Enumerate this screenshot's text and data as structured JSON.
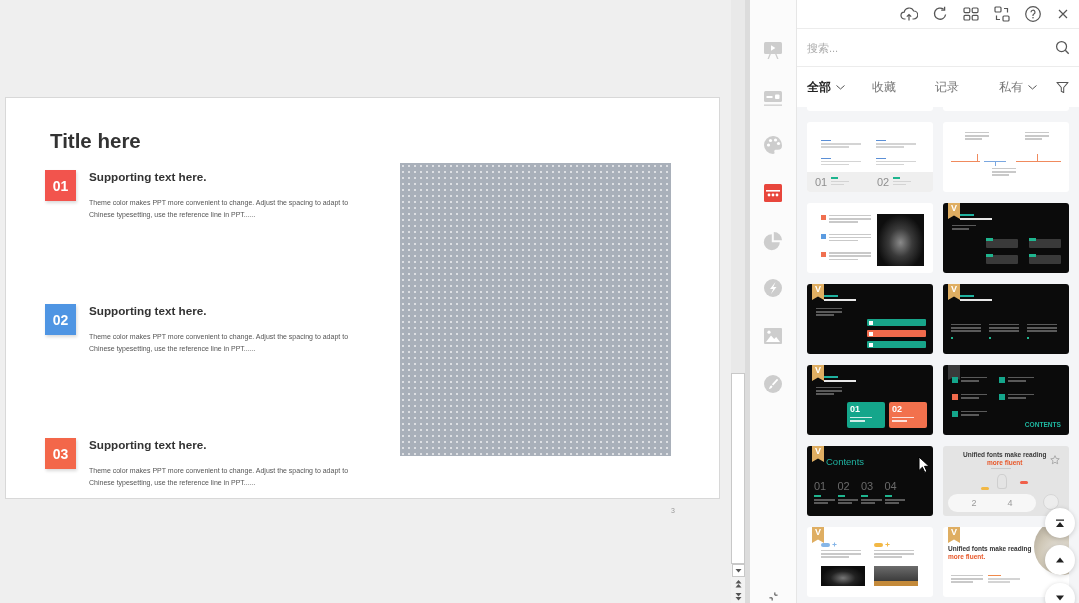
{
  "editor": {
    "slide": {
      "title": "Title here",
      "items": [
        {
          "number": "01",
          "color": "#f2544d",
          "heading": "Supporting text here.",
          "body": "Theme color makes PPT more convenient to change. Adjust the spacing to adapt to Chinese typesetting, use the reference line in PPT......"
        },
        {
          "number": "02",
          "color": "#4f95e3",
          "heading": "Supporting text here.",
          "body": "Theme color makes PPT more convenient to change. Adjust the spacing to adapt to Chinese typesetting, use the reference line in PPT......"
        },
        {
          "number": "03",
          "color": "#f3674a",
          "heading": "Supporting text here.",
          "body": "Theme color makes PPT more convenient to change. Adjust the spacing to adapt to Chinese typesetting, use the reference line in PPT......"
        }
      ],
      "page_number": "3"
    }
  },
  "sidebar": {
    "items": [
      {
        "selected": false
      },
      {
        "selected": false
      },
      {
        "selected": false
      },
      {
        "selected": true
      },
      {
        "selected": false
      },
      {
        "selected": false
      },
      {
        "selected": false
      },
      {
        "selected": false
      }
    ]
  },
  "panel": {
    "search": {
      "placeholder": "搜索..."
    },
    "tabs": [
      {
        "label": "全部",
        "selected": true,
        "dropdown": true
      },
      {
        "label": "收藏",
        "selected": false,
        "dropdown": false
      },
      {
        "label": "记录",
        "selected": false,
        "dropdown": false
      },
      {
        "label": "私有",
        "selected": false,
        "dropdown": true
      }
    ],
    "templates": [
      {
        "kind": "strip",
        "show_favorite": false
      },
      {
        "kind": "strip",
        "show_favorite": false
      },
      {
        "kind": "text-grid",
        "show_favorite": false,
        "numbers": [
          "01",
          "02"
        ]
      },
      {
        "kind": "timeline",
        "show_favorite": false
      },
      {
        "kind": "list-photo",
        "show_favorite": false
      },
      {
        "kind": "dark-cards",
        "show_favorite": false,
        "badge": "V"
      },
      {
        "kind": "dark-bars",
        "show_favorite": false,
        "badge": "V"
      },
      {
        "kind": "dark-columns",
        "show_favorite": false,
        "badge": "V"
      },
      {
        "kind": "dark-tiles",
        "show_favorite": false,
        "badge": "V",
        "numbers": [
          "01",
          "02"
        ]
      },
      {
        "kind": "dark-contents",
        "show_favorite": false,
        "title": "CONTENTS"
      },
      {
        "kind": "dark-numbers",
        "show_favorite": false,
        "badge": "V",
        "title": "Contents",
        "numbers": [
          "01",
          "02",
          "03",
          "04"
        ]
      },
      {
        "kind": "grey-pill",
        "show_favorite": true,
        "title": "Unified fonts make reading",
        "title_accent": "more fluent",
        "numbers": [
          "2",
          "4"
        ]
      },
      {
        "kind": "two-photos",
        "show_favorite": false,
        "badge": "V"
      },
      {
        "kind": "circle-photo",
        "show_favorite": false,
        "badge": "V",
        "title": "Unified fonts make reading",
        "title_accent": "more fluent."
      }
    ]
  }
}
